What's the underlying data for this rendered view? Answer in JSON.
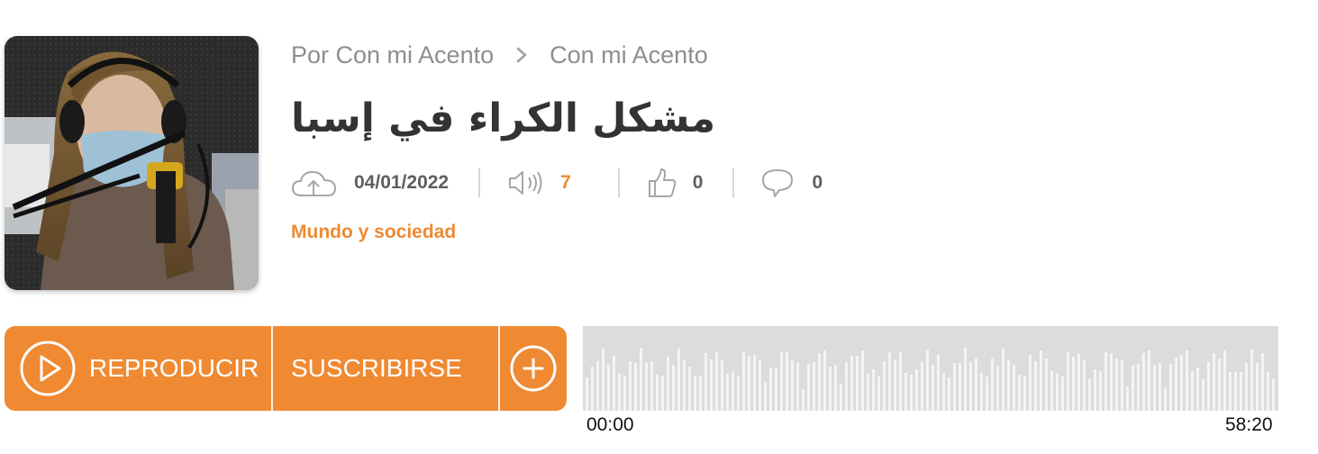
{
  "cover": {
    "alt": "Con mi Acento podcast cover"
  },
  "breadcrumb": {
    "by": "Por Con mi Acento",
    "show": "Con mi Acento"
  },
  "episode": {
    "title": "مشكل الكراء في إسبا",
    "date": "04/01/2022",
    "plays": "7",
    "likes": "0",
    "comments": "0",
    "category": "Mundo y sociedad"
  },
  "actions": {
    "play": "REPRODUCIR",
    "subscribe": "SUSCRIBIRSE"
  },
  "player": {
    "start_time": "00:00",
    "end_time": "58:20"
  },
  "colors": {
    "accent": "#ef8a33",
    "text": "#333333",
    "muted": "#8e8e8e",
    "waveform_bg": "#dcdcdc"
  },
  "icons": [
    "upload-cloud-icon",
    "speaker-icon",
    "thumbs-up-icon",
    "comment-icon",
    "play-icon",
    "plus-icon",
    "chevron-right-icon"
  ]
}
